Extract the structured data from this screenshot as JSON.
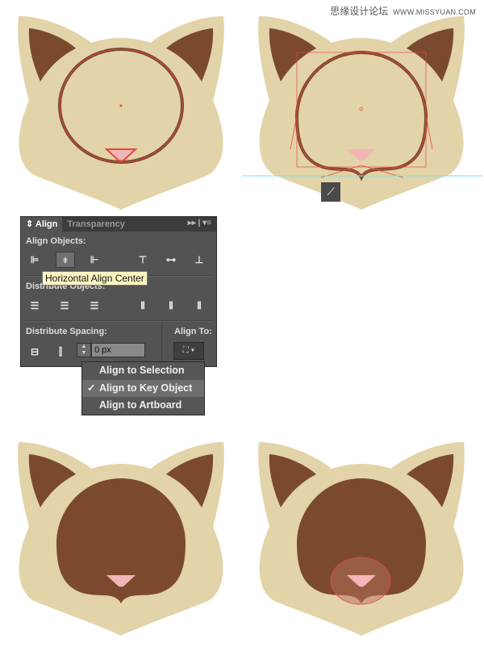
{
  "watermark": {
    "site_name": "思缘设计论坛",
    "url": "WWW.MISSYUAN.COM"
  },
  "colors": {
    "head": "#e2d3a9",
    "ear_inner": "#7b4a2e",
    "face_dark": "#7b4a2e",
    "nose": "#f3b5b8",
    "selection": "#e8463f",
    "guide": "#7fe0e8"
  },
  "panel": {
    "tabs": [
      {
        "label": "Align",
        "active": true
      },
      {
        "label": "Transparency",
        "active": false
      }
    ],
    "menu_icons": [
      "expand-icon",
      "panel-menu-icon"
    ],
    "align_objects_label": "Align Objects:",
    "align_objects_buttons": [
      "horizontal-align-left",
      "horizontal-align-center",
      "horizontal-align-right",
      "vertical-align-top",
      "vertical-align-center",
      "vertical-align-bottom"
    ],
    "selected_button": "horizontal-align-center",
    "tooltip": "Horizontal Align Center",
    "distribute_objects_label": "Distribute Objects:",
    "distribute_spacing_label": "Distribute Spacing:",
    "spacing_value": "0 px",
    "align_to_label": "Align To:"
  },
  "dropdown": {
    "items": [
      {
        "label": "Align to Selection",
        "checked": false
      },
      {
        "label": "Align to Key Object",
        "checked": true
      },
      {
        "label": "Align to Artboard",
        "checked": false
      }
    ],
    "check_mark": "✓"
  }
}
